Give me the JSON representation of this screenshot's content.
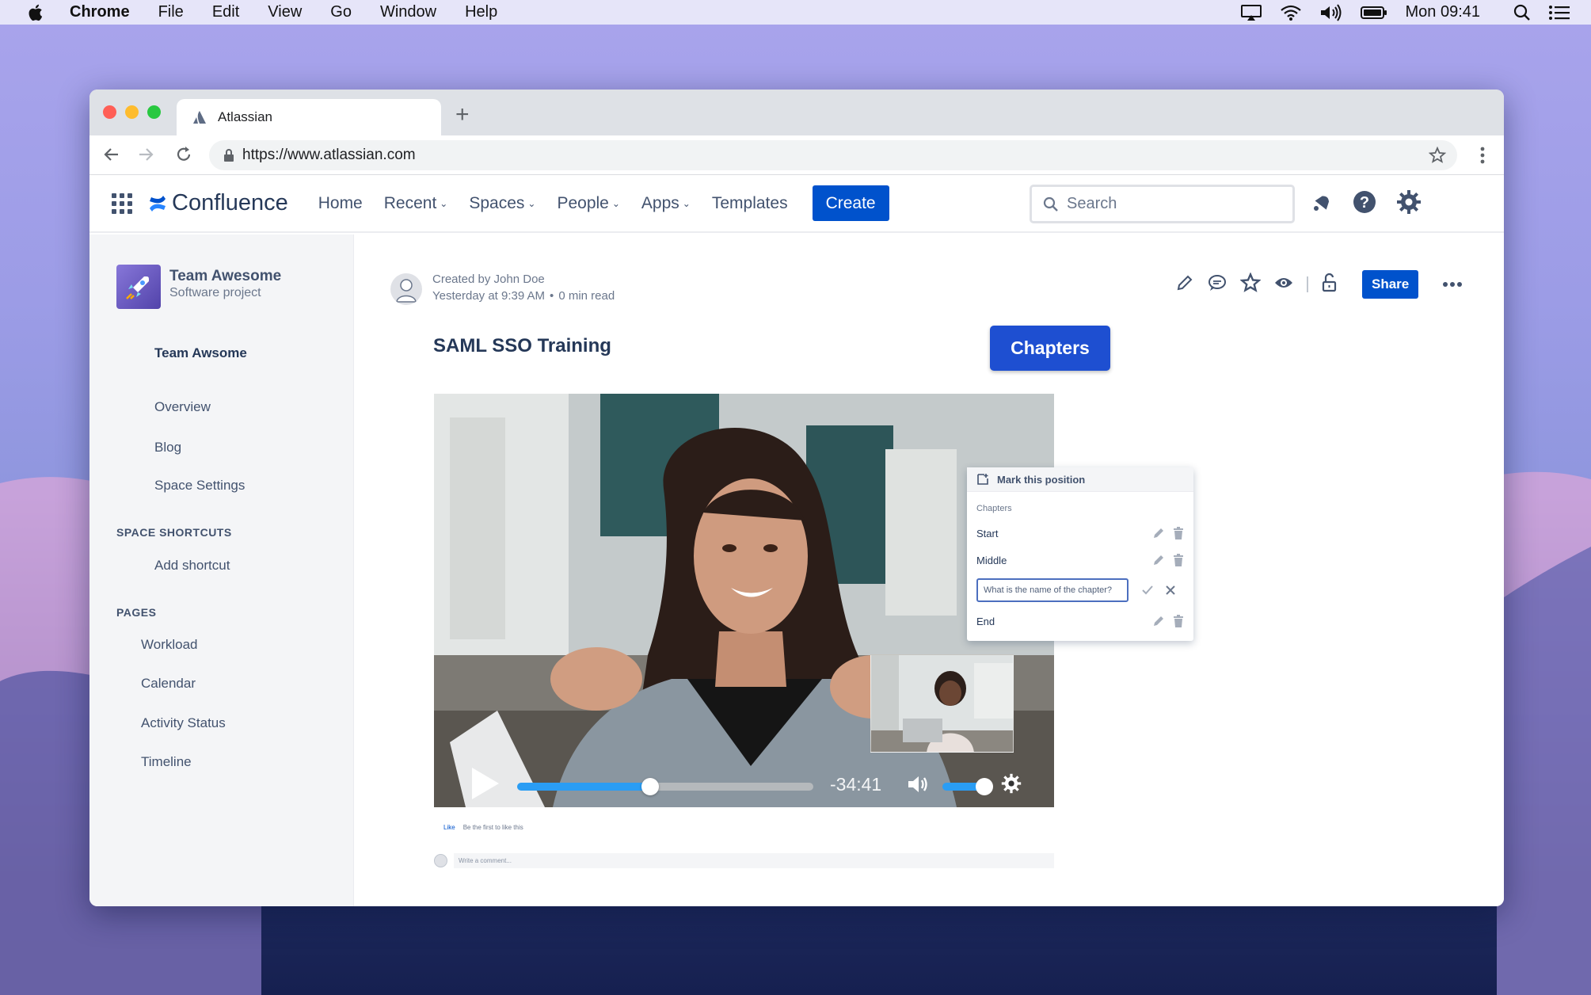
{
  "menubar": {
    "app_name": "Chrome",
    "items": [
      "File",
      "Edit",
      "View",
      "Go",
      "Window",
      "Help"
    ],
    "clock": "Mon 09:41"
  },
  "browser": {
    "tab_title": "Atlassian",
    "url": "https://www.atlassian.com"
  },
  "header": {
    "logo_text": "Confluence",
    "nav": [
      {
        "label": "Home",
        "dropdown": false
      },
      {
        "label": "Recent",
        "dropdown": true
      },
      {
        "label": "Spaces",
        "dropdown": true
      },
      {
        "label": "People",
        "dropdown": true
      },
      {
        "label": "Apps",
        "dropdown": true
      },
      {
        "label": "Templates",
        "dropdown": false
      }
    ],
    "create_label": "Create",
    "search_placeholder": "Search"
  },
  "sidebar": {
    "space_name": "Team Awesome",
    "space_type": "Software project",
    "home_link": "Team Awsome",
    "links": [
      "Overview",
      "Blog",
      "Space Settings"
    ],
    "shortcuts_title": "SPACE SHORTCUTS",
    "add_shortcut": "Add shortcut",
    "pages_title": "PAGES",
    "pages": [
      "Workload",
      "Calendar",
      "Activity Status",
      "Timeline"
    ]
  },
  "page": {
    "created_by": "Created by John Doe",
    "created_when": "Yesterday at 9:39 AM",
    "read_time": "0 min read",
    "share_label": "Share",
    "title": "SAML SSO Training",
    "chapters_button": "Chapters"
  },
  "video": {
    "time_remaining": "-34:41",
    "progress": 0.45,
    "volume": 0.75
  },
  "chapters_panel": {
    "mark_label": "Mark this position",
    "subtitle": "Chapters",
    "rows": [
      {
        "label": "Start"
      },
      {
        "label": "Middle"
      }
    ],
    "input_placeholder": "What is the name of the chapter?",
    "last_row": "End"
  },
  "footer": {
    "like": "Like",
    "be_first": "Be the first to like this",
    "comment_placeholder": "Write a comment..."
  },
  "colors": {
    "primary": "#0052cc",
    "chapters_button": "#1e4fd1",
    "progress": "#2a9df4"
  }
}
